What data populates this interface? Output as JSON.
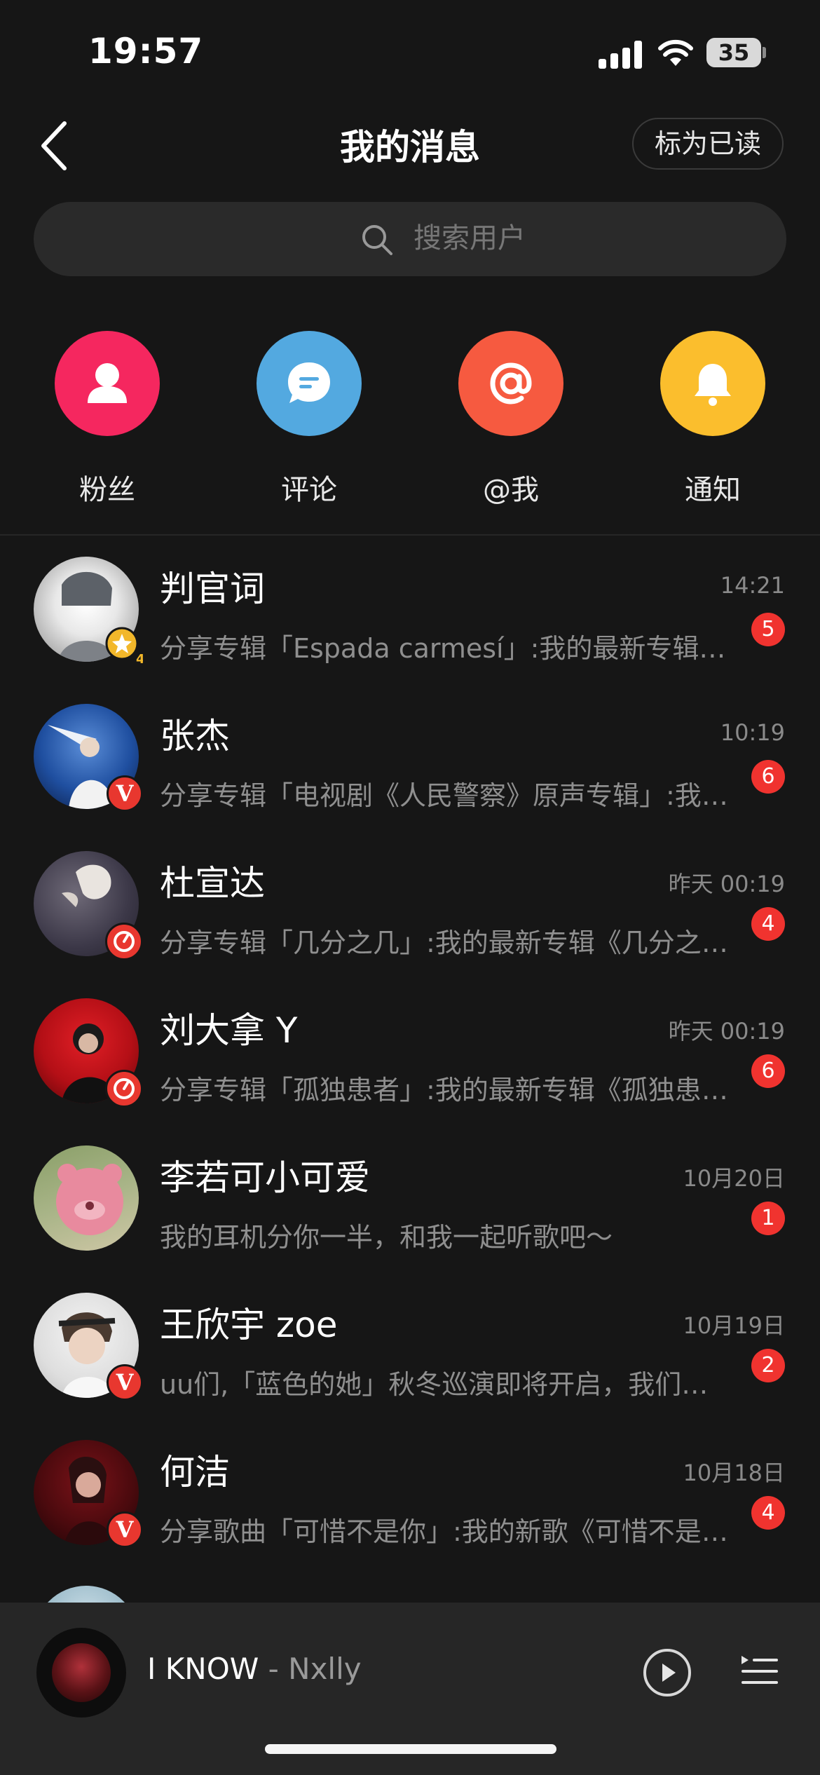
{
  "status_bar": {
    "time": "19:57",
    "battery": "35"
  },
  "header": {
    "title": "我的消息",
    "mark_read": "标为已读"
  },
  "search": {
    "placeholder": "搜索用户"
  },
  "categories": [
    {
      "label": "粉丝",
      "icon": "person-icon",
      "color": "#f5275f"
    },
    {
      "label": "评论",
      "icon": "comment-icon",
      "color": "#53a9e0"
    },
    {
      "label": "@我",
      "icon": "at-icon",
      "color": "#f65a40"
    },
    {
      "label": "通知",
      "icon": "bell-icon",
      "color": "#fbbe2d"
    }
  ],
  "messages": [
    {
      "name": "判官词",
      "time": "14:21",
      "preview": "分享专辑「Espada carmesí」:我的最新专辑《Espada carmesí》",
      "unread": "5",
      "badge": "star",
      "badge_level": "4"
    },
    {
      "name": "张杰",
      "time": "10:19",
      "preview": "分享专辑「电视剧《人民警察》原声专辑」:我的最新专辑",
      "unread": "6",
      "badge": "v"
    },
    {
      "name": "杜宣达",
      "time": "昨天 00:19",
      "preview": "分享专辑「几分之几」:我的最新专辑《几分之几》",
      "unread": "4",
      "badge": "music"
    },
    {
      "name": "刘大拿 Y",
      "time": "昨天 00:19",
      "preview": "分享专辑「孤独患者」:我的最新专辑《孤独患者》",
      "unread": "6",
      "badge": "music"
    },
    {
      "name": "李若可小可爱",
      "time": "10月20日",
      "preview": "我的耳机分你一半，和我一起听歌吧～",
      "unread": "1",
      "badge": "none"
    },
    {
      "name": "王欣宇 zoe",
      "time": "10月19日",
      "preview": "uu们,「蓝色的她」秋冬巡演即将开启，我们一起",
      "unread": "2",
      "badge": "v"
    },
    {
      "name": "何洁",
      "time": "10月18日",
      "preview": "分享歌曲「可惜不是你」:我的新歌《可惜不是你》",
      "unread": "4",
      "badge": "v"
    }
  ],
  "player": {
    "title": "I KNOW",
    "separator": " - ",
    "artist": "Nxlly"
  }
}
